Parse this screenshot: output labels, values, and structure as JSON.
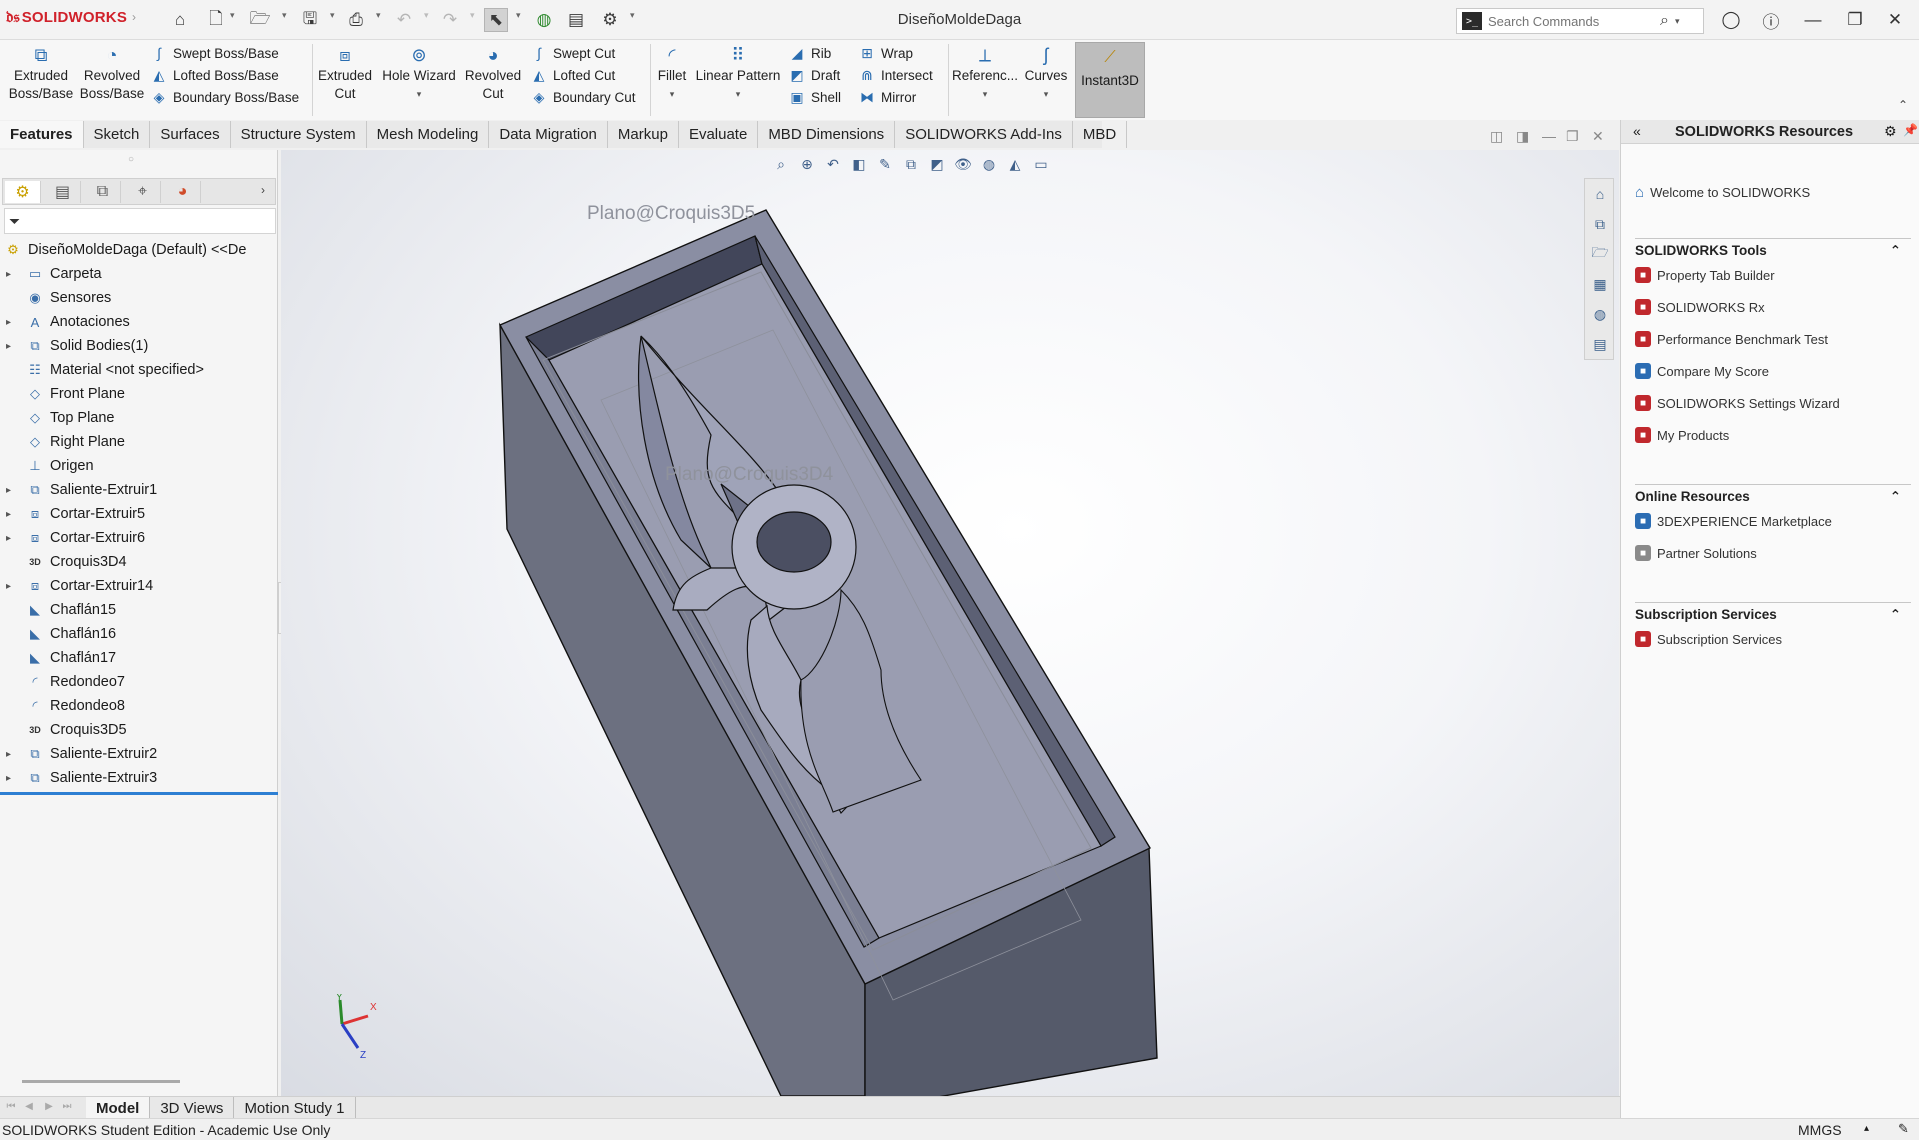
{
  "app": {
    "logo_text": "SOLIDWORKS",
    "document_title": "DiseñoMoldeDaga",
    "brand_color": "#d0212a",
    "quick_access_icons": [
      "home-icon",
      "new-document-icon",
      "open-icon",
      "save-icon",
      "print-icon",
      "undo-icon",
      "redo-icon",
      "select-icon",
      "rebuild-icon",
      "file-properties-icon",
      "options-icon"
    ]
  },
  "search": {
    "placeholder": "Search Commands"
  },
  "ribbon": {
    "extruded_boss": "Extruded\nBoss/Base",
    "revolved_boss": "Revolved\nBoss/Base",
    "swept_boss": "Swept Boss/Base",
    "lofted_boss": "Lofted Boss/Base",
    "boundary_boss": "Boundary Boss/Base",
    "extruded_cut": "Extruded\nCut",
    "hole_wizard": "Hole Wizard",
    "revolved_cut": "Revolved\nCut",
    "swept_cut": "Swept Cut",
    "lofted_cut": "Lofted Cut",
    "boundary_cut": "Boundary Cut",
    "fillet": "Fillet",
    "linear_pattern": "Linear Pattern",
    "rib": "Rib",
    "draft": "Draft",
    "shell": "Shell",
    "wrap": "Wrap",
    "intersect": "Intersect",
    "mirror": "Mirror",
    "reference": "Referenc...",
    "curves": "Curves",
    "instant3d": "Instant3D"
  },
  "tabs": [
    "Features",
    "Sketch",
    "Surfaces",
    "Structure System",
    "Mesh Modeling",
    "Data Migration",
    "Markup",
    "Evaluate",
    "MBD Dimensions",
    "SOLIDWORKS Add-Ins",
    "MBD"
  ],
  "feature_tree": {
    "root": "DiseñoMoldeDaga (Default) <<De",
    "items": [
      {
        "label": "Carpeta",
        "expandable": true,
        "icon": "folder-icon"
      },
      {
        "label": "Sensores",
        "expandable": false,
        "icon": "sensor-icon"
      },
      {
        "label": "Anotaciones",
        "expandable": true,
        "icon": "annotations-icon"
      },
      {
        "label": "Solid Bodies(1)",
        "expandable": true,
        "icon": "solid-bodies-icon"
      },
      {
        "label": "Material <not specified>",
        "expandable": false,
        "icon": "material-icon"
      },
      {
        "label": "Front Plane",
        "expandable": false,
        "icon": "plane-icon"
      },
      {
        "label": "Top Plane",
        "expandable": false,
        "icon": "plane-icon"
      },
      {
        "label": "Right Plane",
        "expandable": false,
        "icon": "plane-icon"
      },
      {
        "label": "Origen",
        "expandable": false,
        "icon": "origin-icon"
      },
      {
        "label": "Saliente-Extruir1",
        "expandable": true,
        "icon": "extrude-icon"
      },
      {
        "label": "Cortar-Extruir5",
        "expandable": true,
        "icon": "cut-extrude-icon"
      },
      {
        "label": "Cortar-Extruir6",
        "expandable": true,
        "icon": "cut-extrude-icon"
      },
      {
        "label": "Croquis3D4",
        "expandable": false,
        "icon": "sketch3d-icon"
      },
      {
        "label": "Cortar-Extruir14",
        "expandable": true,
        "icon": "cut-extrude-icon"
      },
      {
        "label": "Chaflán15",
        "expandable": false,
        "icon": "chamfer-icon"
      },
      {
        "label": "Chaflán16",
        "expandable": false,
        "icon": "chamfer-icon"
      },
      {
        "label": "Chaflán17",
        "expandable": false,
        "icon": "chamfer-icon"
      },
      {
        "label": "Redondeo7",
        "expandable": false,
        "icon": "fillet-icon"
      },
      {
        "label": "Redondeo8",
        "expandable": false,
        "icon": "fillet-icon"
      },
      {
        "label": "Croquis3D5",
        "expandable": false,
        "icon": "sketch3d-icon"
      },
      {
        "label": "Saliente-Extruir2",
        "expandable": true,
        "icon": "extrude-icon"
      },
      {
        "label": "Saliente-Extruir3",
        "expandable": true,
        "icon": "extrude-icon"
      }
    ]
  },
  "viewport": {
    "labels": [
      "Plano@Croquis3D5",
      "Plano@Croquis3D4"
    ],
    "axis_labels": {
      "x": "X",
      "y": "Y",
      "z": "Z"
    }
  },
  "bottom_tabs": [
    "Model",
    "3D Views",
    "Motion Study 1"
  ],
  "status": {
    "text": "SOLIDWORKS Student Edition - Academic Use Only",
    "units": "MMGS"
  },
  "task_pane": {
    "title": "SOLIDWORKS Resources",
    "welcome": "Welcome to SOLIDWORKS",
    "sections": [
      {
        "title": "SOLIDWORKS Tools",
        "items": [
          "Property Tab Builder",
          "SOLIDWORKS Rx",
          "Performance Benchmark Test",
          "Compare My Score",
          "SOLIDWORKS Settings Wizard",
          "My Products"
        ]
      },
      {
        "title": "Online Resources",
        "items": [
          "3DEXPERIENCE Marketplace",
          "Partner Solutions"
        ]
      },
      {
        "title": "Subscription Services",
        "items": [
          "Subscription Services"
        ]
      }
    ]
  }
}
